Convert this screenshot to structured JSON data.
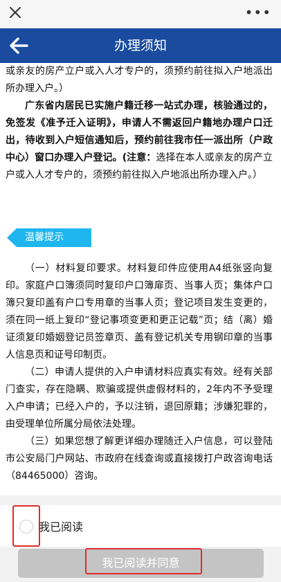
{
  "nav": {
    "title": "办理须知"
  },
  "content": {
    "para0": "或亲友的房产立户或入人才专户的，须预约前往拟入户地派出所办理入户。）",
    "para1_bold": "广东省内居民已实施户籍迁移一站式办理，核验通过的，免签发《准予迁入证明》，申请人不需返回户籍地办理户口迁出，待收到入户短信通知后，预约前往我市任一派出所（户政中心）窗口办理入户登记。(注意：",
    "para1_rest": "选择在本人或亲友的房产立户或入人才专户的，须预约前往拟入户地派出所办理入户。）",
    "tip_label": "温馨提示",
    "item1": "（一）材料复印要求。材料复印件应使用A4纸张竖向复印。家庭户口簿须同时复印户口簿扉页、当事人页；集体户口簿只复印盖有户口专用章的当事人页；登记项目发生变更的，须在同一纸上复印“登记事项变更和更正记载”页；结（离）婚证须复印婚姻登记员签章页、盖有登记机关专用钢印章的当事人信息页和证号印制页。",
    "item2": "（二）申请人提供的入户申请材料应真实有效。经有关部门查实，存在隐瞒、欺骗或提供虚假材料的，2年内不予受理入户申请；已经入户的，予以注销，退回原籍；涉嫌犯罪的，由受理单位所属分局依法处理。",
    "item3": "（三）如果您想了解更详细办理随迁入户信息，可以登陆市公安局门户网站、市政府在线查询或直接拨打户政咨询电话（84465000）咨询。"
  },
  "footer": {
    "agree_label": "我已阅读",
    "submit_label": "我已阅读并同意",
    "button_color": "#c4c4c4",
    "highlight_color": "#e02b2b"
  },
  "colors": {
    "header": "#1a4b9e",
    "tip": "#1fb6f0"
  },
  "icons": {
    "close": "close-icon",
    "more": "more-icon",
    "back": "back-arrow-icon"
  }
}
